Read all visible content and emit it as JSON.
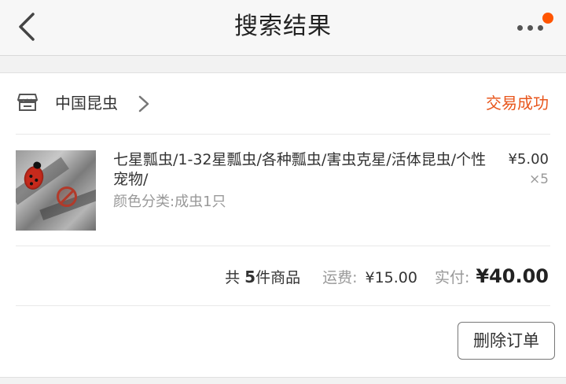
{
  "header": {
    "title": "搜索结果",
    "back_icon": "chevron-left-icon",
    "more_icon": "more-dots-icon",
    "badge_color": "#ff5500"
  },
  "order": {
    "shop": {
      "icon": "store-icon",
      "name": "中国昆虫",
      "chevron_icon": "chevron-right-icon"
    },
    "status": "交易成功",
    "status_color": "#e8561c",
    "item": {
      "title": "七星瓢虫/1-32星瓢虫/各种瓢虫/害虫克星/活体昆虫/个性宠物/",
      "sku": "颜色分类:成虫1只",
      "price": "¥5.00",
      "quantity": "×5"
    },
    "summary": {
      "count_prefix": "共 ",
      "count": "5",
      "count_suffix": "件商品",
      "shipping_label": "运费:",
      "shipping_value": "¥15.00",
      "total_label": "实付:",
      "total_value": "¥40.00"
    },
    "actions": {
      "delete_label": "删除订单"
    }
  }
}
